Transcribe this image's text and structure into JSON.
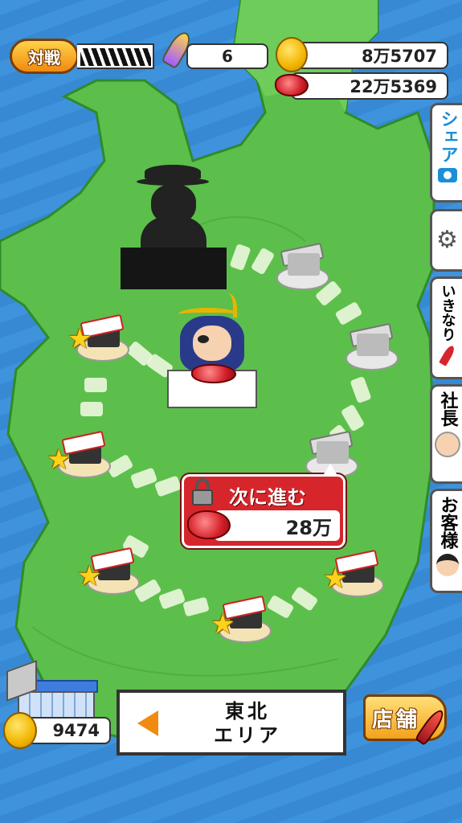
{
  "hud": {
    "battle_label": "対戦",
    "rocket_count": "6",
    "coins": "8万5707",
    "meat": "22万5369"
  },
  "side_tabs": {
    "share": "シェア",
    "ikinari": "いきなり",
    "president": "社長",
    "customers": "お客様"
  },
  "next_panel": {
    "title": "次に進む",
    "cost": "28万"
  },
  "bottom": {
    "hq_coins": "9474",
    "area_name": "東北\nエリア",
    "store_label": "店舗"
  },
  "colors": {
    "land": "#5cbf4b",
    "sea": "#3a8fd8",
    "accent_red": "#d6262c",
    "gold": "#f2b400"
  }
}
